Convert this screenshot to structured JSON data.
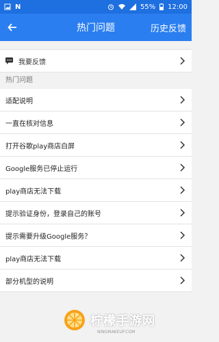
{
  "status_bar": {
    "notification_glyph": "N",
    "battery": "55%",
    "time": "12:00"
  },
  "app_bar": {
    "title": "热门问题",
    "right_action": "历史反馈"
  },
  "feedback": {
    "label": "我要反馈"
  },
  "section_title": "热门问题",
  "items": [
    {
      "label": "适配说明"
    },
    {
      "label": "一直在核对信息"
    },
    {
      "label": "打开谷歌play商店白屏"
    },
    {
      "label": "Google服务已停止运行"
    },
    {
      "label": "play商店无法下载"
    },
    {
      "label": "提示验证身份，登录自己的账号"
    },
    {
      "label": "提示需要升级Google服务？"
    },
    {
      "label": "play商店无法下载"
    },
    {
      "label": "部分机型的说明"
    }
  ],
  "watermark": {
    "text": "柠檬手游网",
    "sub": "NINGMAKEUP.COM"
  },
  "colors": {
    "status_bar": "#1e6fe0",
    "app_bar": "#2a7ef0",
    "background": "#f2f2f2"
  }
}
